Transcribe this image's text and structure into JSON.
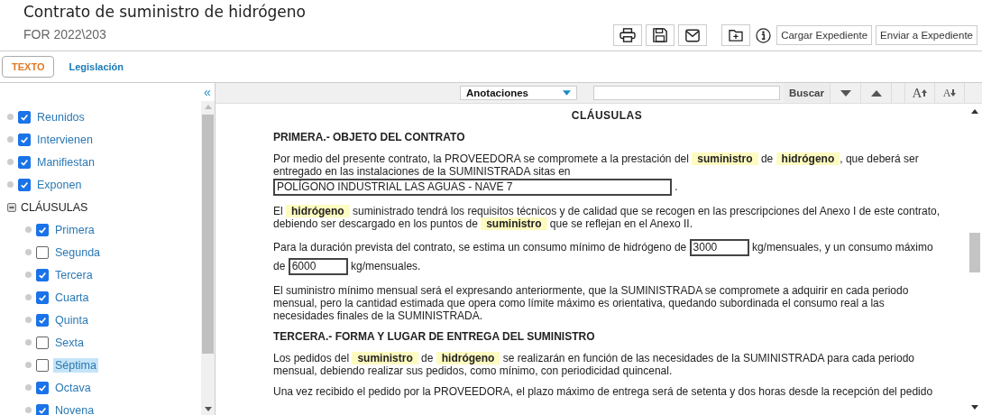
{
  "header": {
    "title": "Contrato de suministro de hidrógeno",
    "code": "FOR 2022\\203",
    "actions": [
      {
        "kind": "print"
      },
      {
        "kind": "save"
      },
      {
        "kind": "mail"
      },
      {
        "kind": "folder-add"
      },
      {
        "kind": "info"
      },
      {
        "kind": "text",
        "label": "Cargar Expediente"
      },
      {
        "kind": "text",
        "label": "Enviar a Expediente"
      }
    ]
  },
  "tabs": [
    {
      "label": "TEXTO",
      "selected": true
    },
    {
      "label": "Legislación",
      "selected": false
    }
  ],
  "sidebar": {
    "collapse": "«",
    "items": [
      {
        "label": "Reunidos",
        "checked": true,
        "selected": false
      },
      {
        "label": "Intervienen",
        "checked": true,
        "selected": false
      },
      {
        "label": "Manifiestan",
        "checked": true,
        "selected": false
      },
      {
        "label": "Exponen",
        "checked": true,
        "selected": false
      },
      {
        "label": "CLÁUSULAS",
        "expanded": true,
        "children": [
          {
            "label": "Primera",
            "checked": true,
            "selected": false
          },
          {
            "label": "Segunda",
            "checked": false,
            "selected": false
          },
          {
            "label": "Tercera",
            "checked": true,
            "selected": false
          },
          {
            "label": "Cuarta",
            "checked": true,
            "selected": false
          },
          {
            "label": "Quinta",
            "checked": true,
            "selected": false
          },
          {
            "label": "Sexta",
            "checked": false,
            "selected": false
          },
          {
            "label": "Séptima",
            "checked": false,
            "selected": true
          },
          {
            "label": "Octava",
            "checked": true,
            "selected": false
          },
          {
            "label": "Novena",
            "checked": true,
            "selected": false
          }
        ]
      }
    ]
  },
  "toolbar": {
    "dropdown": "Anotaciones",
    "search_button": "Buscar",
    "font_buttons": [
      {
        "kind": "increase",
        "label": "A"
      },
      {
        "kind": "decrease",
        "label": "A"
      }
    ]
  },
  "document": [
    {
      "kind": "title",
      "text": "CLÁUSULAS"
    },
    {
      "kind": "heading",
      "text": "PRIMERA.- OBJETO DEL CONTRATO"
    },
    {
      "kind": "para",
      "segments": [
        {
          "kind": "text",
          "text": "Por medio del presente contrato, la PROVEEDORA se compromete a la prestación del "
        },
        {
          "kind": "term",
          "text": "suministro"
        },
        {
          "kind": "text",
          "text": " de "
        },
        {
          "kind": "term",
          "text": "hidrógeno"
        },
        {
          "kind": "text",
          "text": ", que deberá ser entregado en las instalaciones de la SUMINISTRADA sitas en "
        },
        {
          "kind": "field",
          "text": "POLÍGONO INDUSTRIAL LAS AGUAS - NAVE 7",
          "wide": true
        },
        {
          "kind": "text",
          "text": " ."
        }
      ]
    },
    {
      "kind": "para",
      "segments": [
        {
          "kind": "text",
          "text": "El "
        },
        {
          "kind": "term",
          "text": "hidrógeno"
        },
        {
          "kind": "text",
          "text": " suministrado tendrá los requisitos técnicos y de calidad que se recogen en las prescripciones del Anexo I de este contrato, debiendo ser descargado en los puntos de "
        },
        {
          "kind": "term",
          "text": "suministro"
        },
        {
          "kind": "text",
          "text": " que se reflejan en el Anexo II."
        }
      ]
    },
    {
      "kind": "para",
      "segments": [
        {
          "kind": "text",
          "text": "Para la duración prevista del contrato, se estima un consumo mínimo de hidrógeno de "
        },
        {
          "kind": "field",
          "text": "3000",
          "wide": false
        },
        {
          "kind": "text",
          "text": " kg/mensuales, y un consumo máximo de "
        },
        {
          "kind": "field",
          "text": "6000",
          "wide": false
        },
        {
          "kind": "text",
          "text": " kg/mensuales."
        }
      ]
    },
    {
      "kind": "para",
      "segments": [
        {
          "kind": "text",
          "text": "El suministro mínimo mensual será el expresando anteriormente, que la SUMINISTRADA se compromete a adquirir en cada periodo mensual, pero la cantidad estimada que opera como límite máximo es orientativa, quedando subordinada el consumo real a las necesidades finales de la SUMINISTRADA."
        }
      ]
    },
    {
      "kind": "heading",
      "text": "TERCERA.- FORMA Y LUGAR DE ENTREGA DEL SUMINISTRO"
    },
    {
      "kind": "para",
      "segments": [
        {
          "kind": "text",
          "text": "Los pedidos del "
        },
        {
          "kind": "term",
          "text": "suministro"
        },
        {
          "kind": "text",
          "text": " de "
        },
        {
          "kind": "term",
          "text": "hidrógeno"
        },
        {
          "kind": "text",
          "text": " se realizarán en función de las necesidades de la SUMINISTRADA para cada periodo mensual, debiendo realizar sus pedidos, como mínimo, con periodicidad quincenal."
        }
      ]
    },
    {
      "kind": "para",
      "segments": [
        {
          "kind": "text",
          "text": "Una vez recibido el pedido por la PROVEEDORA, el plazo máximo de entrega será de setenta y dos horas desde la recepción del pedido"
        }
      ]
    }
  ]
}
